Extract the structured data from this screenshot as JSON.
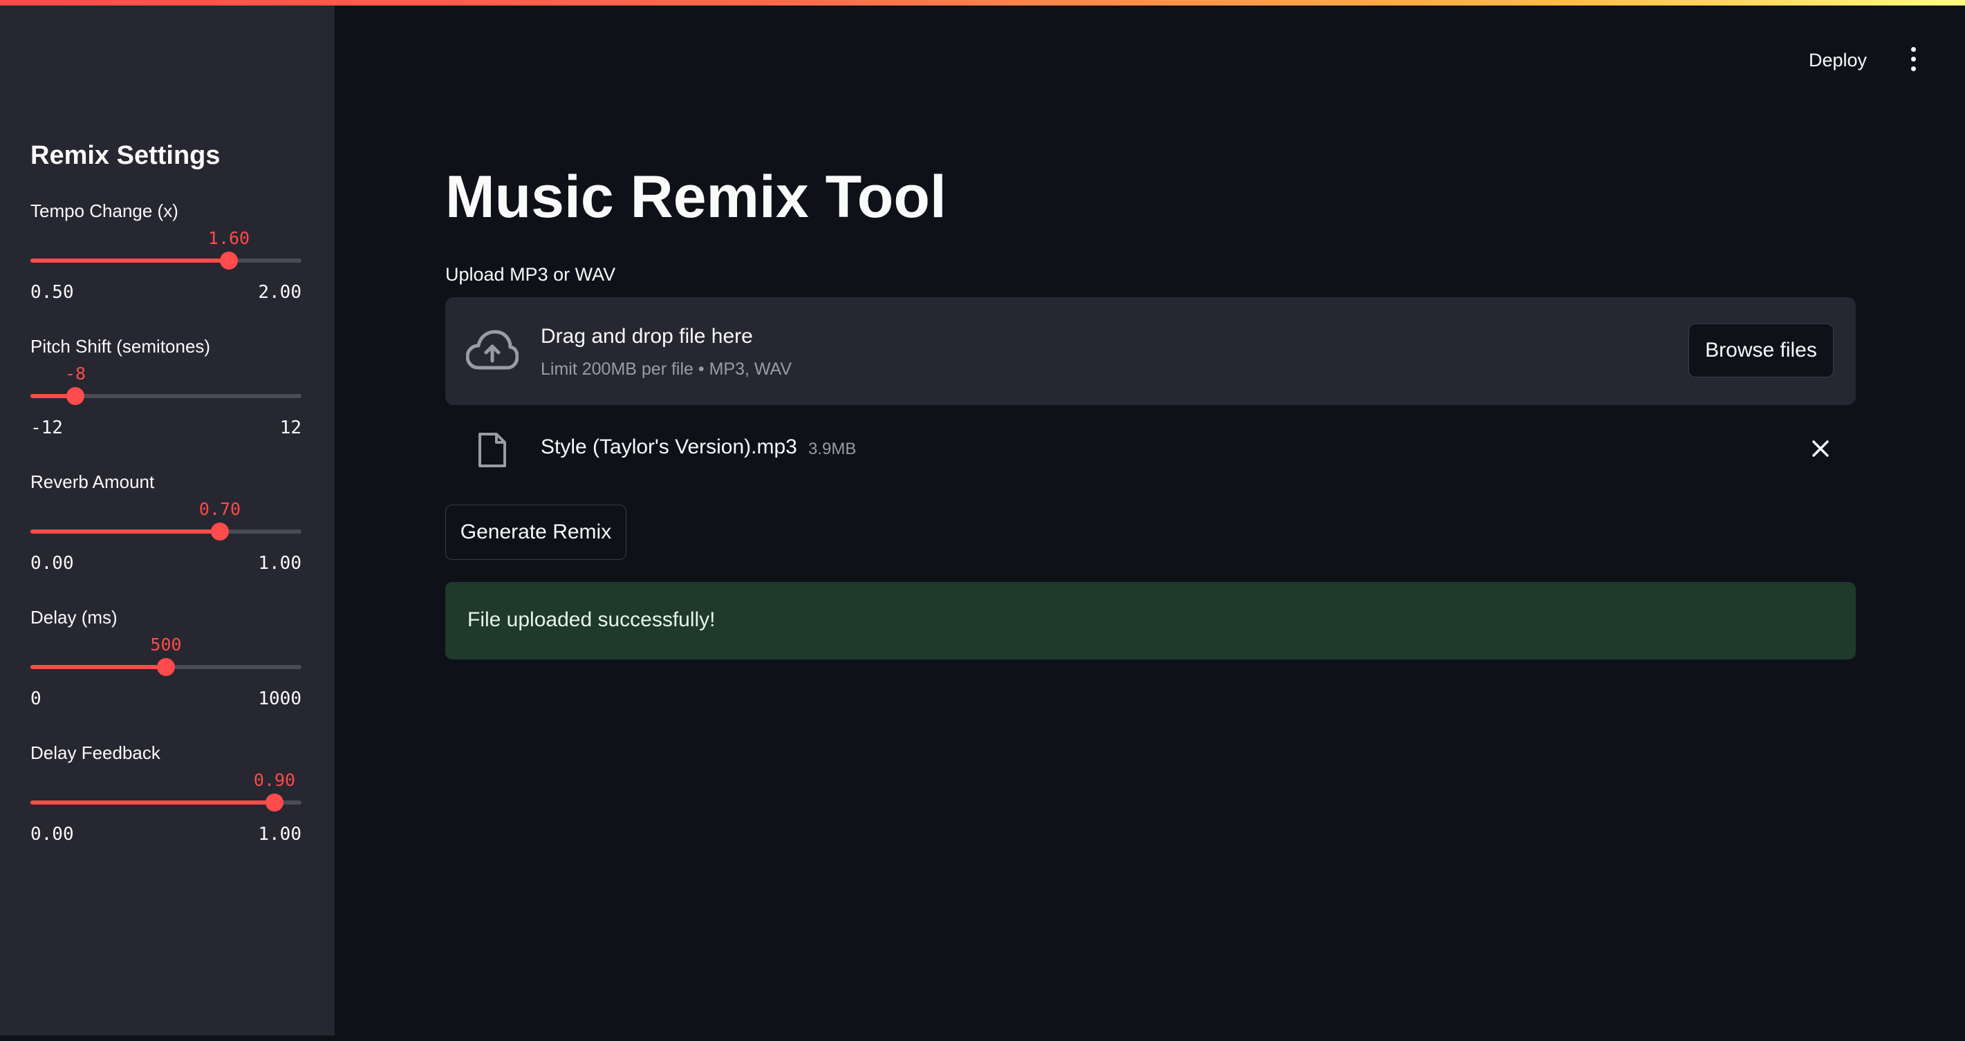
{
  "header": {
    "deploy_label": "Deploy",
    "menu_icon": "kebab-menu-icon"
  },
  "sidebar": {
    "title": "Remix Settings",
    "sliders": [
      {
        "label": "Tempo Change (x)",
        "value": "1.60",
        "min": "0.50",
        "max": "2.00",
        "fraction": 0.733
      },
      {
        "label": "Pitch Shift (semitones)",
        "value": "-8",
        "min": "-12",
        "max": "12",
        "fraction": 0.167
      },
      {
        "label": "Reverb Amount",
        "value": "0.70",
        "min": "0.00",
        "max": "1.00",
        "fraction": 0.7
      },
      {
        "label": "Delay (ms)",
        "value": "500",
        "min": "0",
        "max": "1000",
        "fraction": 0.5
      },
      {
        "label": "Delay Feedback",
        "value": "0.90",
        "min": "0.00",
        "max": "1.00",
        "fraction": 0.9
      }
    ]
  },
  "main": {
    "title": "Music Remix Tool",
    "upload": {
      "label": "Upload MP3 or WAV",
      "drop_text": "Drag and drop file here",
      "limit_text": "Limit 200MB per file • MP3, WAV",
      "browse_label": "Browse files"
    },
    "file": {
      "name": "Style (Taylor's Version).mp3",
      "size": "3.9MB"
    },
    "generate_label": "Generate Remix",
    "success_message": "File uploaded successfully!"
  },
  "colors": {
    "accent": "#ff4b4b",
    "background": "#0e1117",
    "sidebar": "#262730",
    "success_bg": "#1f3a2b"
  }
}
